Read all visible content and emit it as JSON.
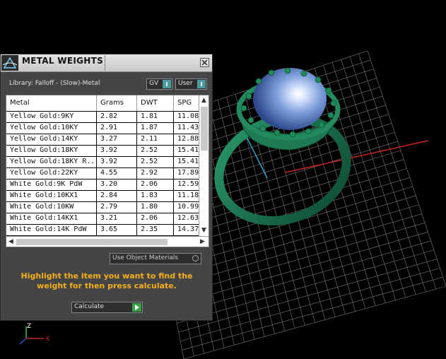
{
  "panel": {
    "title": "METAL WEIGHTS",
    "library_label": "Library: Falloff - (Slow)-Metal",
    "gv_label": "GV",
    "user_label": "User",
    "use_object_materials_label": "Use Object Materials",
    "instruction": "Highlight the item you want to find the weight for then press calculate.",
    "calculate_label": "Calculate"
  },
  "table": {
    "headers": [
      "Metal",
      "Grams",
      "DWT",
      "SPG"
    ],
    "rows": [
      [
        "Yellow Gold:9KY",
        "2.82",
        "1.81",
        "11.08"
      ],
      [
        "Yellow Gold:10KY",
        "2.91",
        "1.87",
        "11.43"
      ],
      [
        "Yellow Gold:14KY",
        "3.27",
        "2.11",
        "12.88"
      ],
      [
        "Yellow Gold:18KY",
        "3.92",
        "2.52",
        "15.41"
      ],
      [
        "Yellow Gold:18KY R...",
        "3.92",
        "2.52",
        "15.41"
      ],
      [
        "Yellow Gold:22KY",
        "4.55",
        "2.92",
        "17.89"
      ],
      [
        "White Gold:9K PdW",
        "3.20",
        "2.06",
        "12.59"
      ],
      [
        "White Gold:10KX1",
        "2.84",
        "1.83",
        "11.18"
      ],
      [
        "White Gold:10KW",
        "2.79",
        "1.80",
        "10.99"
      ],
      [
        "White Gold:14KX1",
        "3.21",
        "2.06",
        "12.63"
      ],
      [
        "White Gold:14K PdW",
        "3.65",
        "2.35",
        "14.37"
      ]
    ]
  },
  "axis": {
    "z_label": "Z",
    "x_label": "X"
  },
  "colors": {
    "panel_bg": "#454545",
    "ring": "#1f7a55",
    "gem": "#8fb0e8",
    "instruction_text": "#f3b01c",
    "axis_x": "#cc2222",
    "axis_y": "#29a9c9"
  }
}
